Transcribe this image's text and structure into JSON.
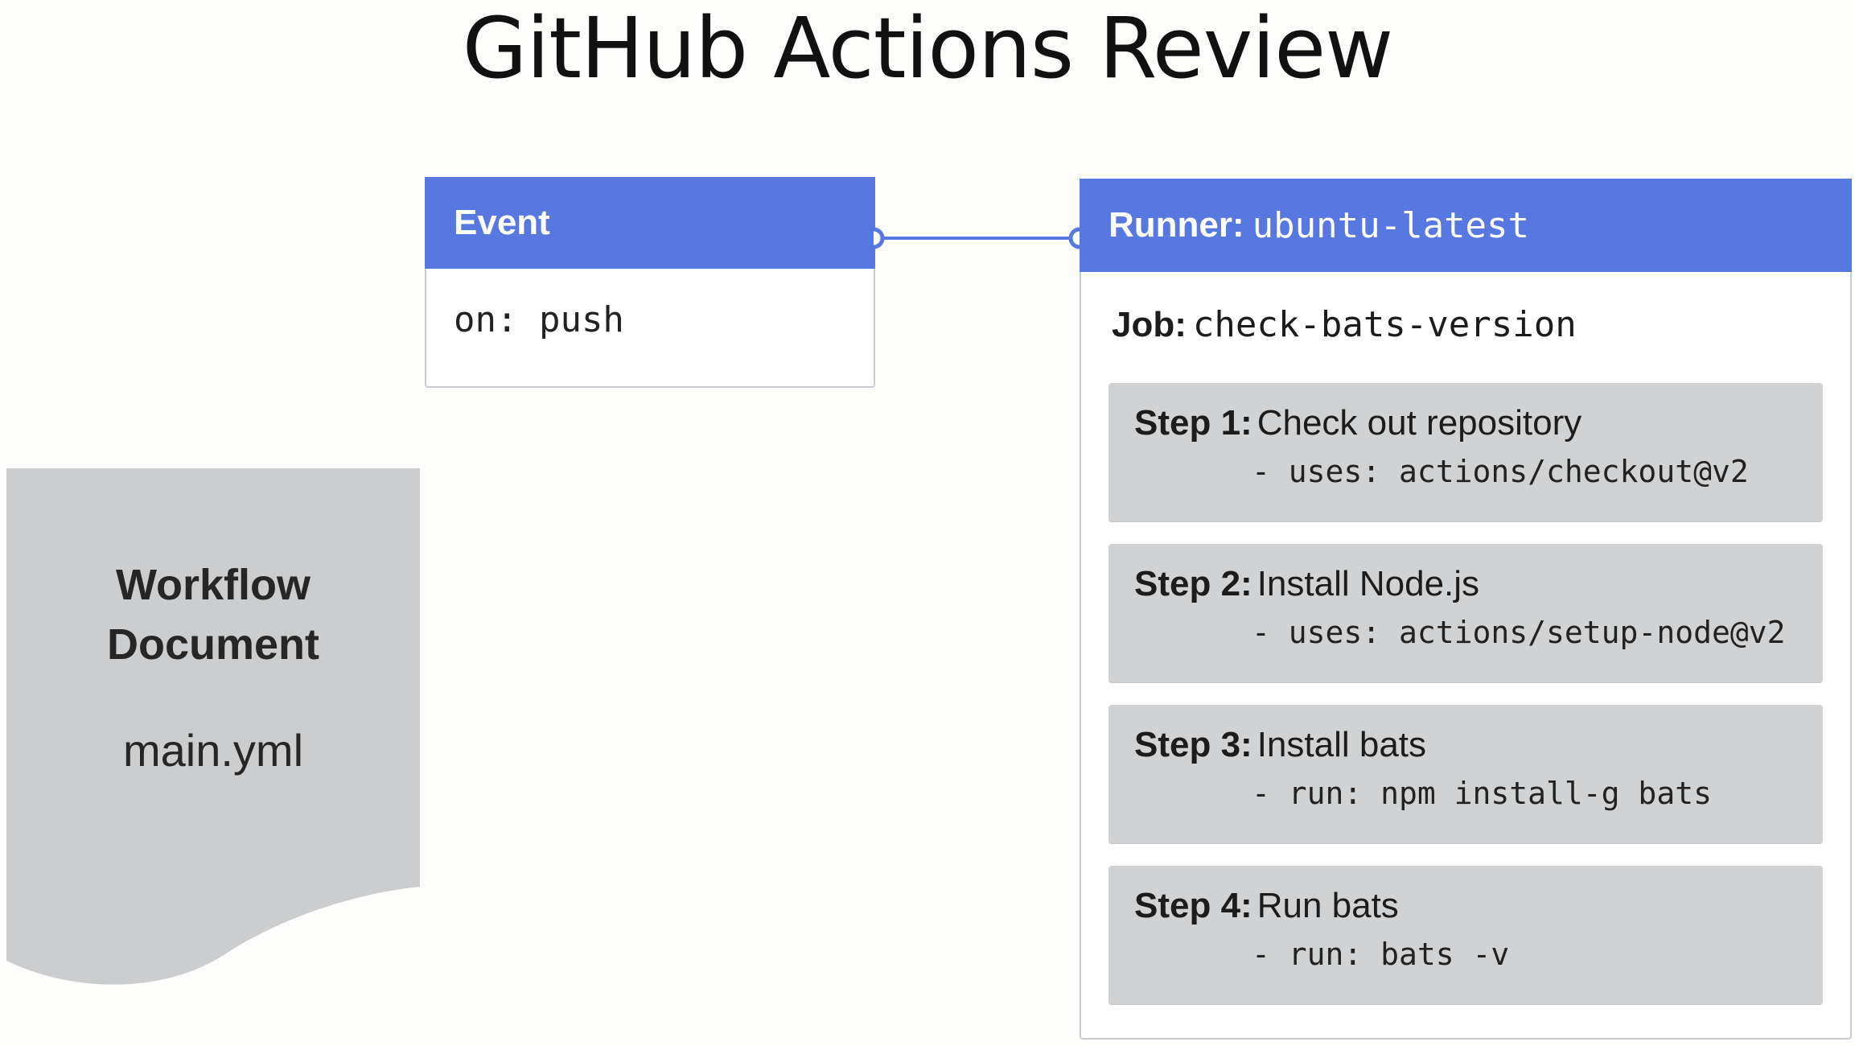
{
  "title": "GitHub Actions Review",
  "event": {
    "header": "Event",
    "body": "on: push"
  },
  "runner": {
    "label": "Runner:",
    "value": "ubuntu-latest",
    "job_label": "Job:",
    "job_value": "check-bats-version",
    "steps": [
      {
        "label": "Step 1:",
        "title": "Check out repository",
        "cmd": "- uses: actions/checkout@v2"
      },
      {
        "label": "Step 2:",
        "title": "Install Node.js",
        "cmd": "- uses: actions/setup-node@v2"
      },
      {
        "label": "Step 3:",
        "title": "Install bats",
        "cmd": "- run: npm install-g bats"
      },
      {
        "label": "Step 4:",
        "title": "Run bats",
        "cmd": "- run: bats -v"
      }
    ]
  },
  "document": {
    "title_line1": "Workflow",
    "title_line2": "Document",
    "file": "main.yml"
  },
  "colors": {
    "accent": "#5778e1",
    "step_bg": "#d0d2d3",
    "doc_bg": "#cbcdce"
  }
}
